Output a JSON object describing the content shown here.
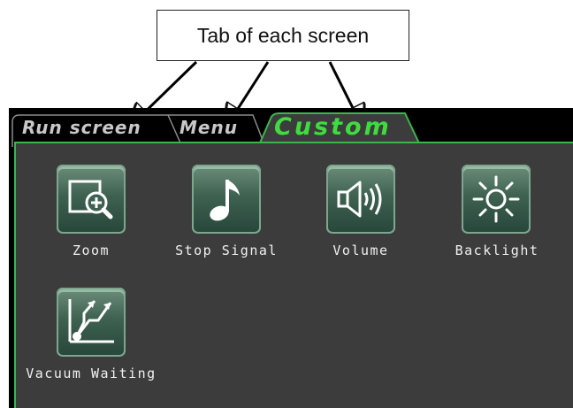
{
  "callout": {
    "text": "Tab of each screen"
  },
  "tabs": [
    {
      "label": "Run screen",
      "active": false
    },
    {
      "label": "Menu",
      "active": false
    },
    {
      "label": "Custom",
      "active": true
    }
  ],
  "buttons": [
    {
      "label": "Zoom",
      "icon": "zoom-in-icon"
    },
    {
      "label": "Stop Signal",
      "icon": "music-note-icon"
    },
    {
      "label": "Volume",
      "icon": "speaker-icon"
    },
    {
      "label": "Backlight",
      "icon": "sun-icon"
    },
    {
      "label": "Vacuum Waiting",
      "icon": "vacuum-graph-icon"
    }
  ],
  "colors": {
    "accent": "#38b84a",
    "panel": "#3c3c3c",
    "screen": "#000000"
  }
}
